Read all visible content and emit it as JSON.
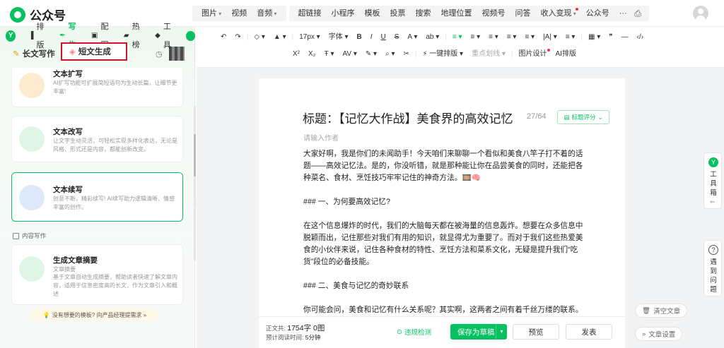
{
  "app": {
    "title": "公众号"
  },
  "topnav": {
    "group1": [
      "图片",
      "视频",
      "音频"
    ],
    "group2": [
      "超链接",
      "小程序",
      "模板",
      "投票",
      "搜索",
      "地理位置",
      "视频号",
      "问答",
      "收入变现",
      "公众号",
      "···"
    ]
  },
  "left": {
    "tabs": [
      "排版",
      "写作",
      "配图",
      "热榜",
      "工具"
    ],
    "modes": {
      "long": "长文写作",
      "short": "短文生成"
    },
    "cards": [
      {
        "title": "文本扩写",
        "desc": "AI扩写功能可扩展简短语句为生动长篇，让细节更丰富!"
      },
      {
        "title": "文本改写",
        "desc": "让文字生动灵活，可轻松实现多样化表达，无论是风格、形式还是内容，都能创新改变。"
      },
      {
        "title": "文本续写",
        "desc": "创意不断，精彩续写! AI续写助力逻辑清晰、情感丰富的创作。"
      },
      {
        "title": "生成文章摘要",
        "sub": "文章摘要",
        "desc": "基于文章自动生成摘要，帮助读者快速了解文章内容，适用于信息密度高的长文，作为文章引入和概述"
      }
    ],
    "section": "内容写作",
    "hint": "没有想要的模板? 向产品经理提需求 »"
  },
  "toolbar": {
    "row1": [
      "↶",
      "↷",
      "|",
      "◇ ▾",
      "▲ ▾",
      "|",
      "17px ▾",
      "字体 ▾",
      "B",
      "I",
      "U",
      "S",
      "A ▾",
      "ab ▾",
      "|",
      "≡ ▾",
      "≡ ▾",
      "≡ ▾",
      "≡ ▾",
      "≡ ▾",
      "|A| ▾",
      "≡ ▾",
      "|",
      "▦ ▾",
      "❞",
      "—",
      "‹/›"
    ],
    "row2": [
      "X²",
      "X₂",
      "Ŧ ▾",
      "AV ▾",
      "✎ ▾",
      "⌕ ▾",
      "✂",
      "|",
      "⚡ 一键排版 ▾",
      "重点划线 ▾",
      "|",
      "图片设计",
      "AI排版"
    ]
  },
  "editor": {
    "title": "标题：【记忆大作战】美食界的高效记忆",
    "title_count": "27/64",
    "score_label": "标题评分",
    "author_placeholder": "请输入作者",
    "paragraphs": [
      "大家好啊，我是你们的未闻助手！今天咱们来聊聊一个看似和美食八竿子打不着的话题——高效记忆法。是的，你没听错，就是那种能让你在品尝美食的同时，还能把各种菜名、食材、烹饪技巧牢牢记住的神奇方法。🎞️🧠",
      "### 一、为何要高效记忆?",
      "在这个信息爆炸的时代，我们的大脑每天都在被海量的信息轰炸。想要在众多信息中脱颖而出，记住那些对我们有用的知识，就显得尤为重要了。而对于我们这些热爱美食的小伙伴来说，记住各种食材的特性、烹饪方法和菜系文化，无疑是提升我们“吃货”段位的必备技能。",
      "### 二、美食与记忆的奇妙联系",
      "你可能会问，美食和记忆有什么关系呢？其实啊，这两者之间有着千丝万缕的联系。🥢🍃"
    ]
  },
  "footer": {
    "word_label": "正文共:",
    "word_value": "1754字 0图",
    "time_label": "预计阅读时间:",
    "time_value": "5分钟",
    "check": "违规检测",
    "save": "保存为草稿",
    "preview": "预览",
    "publish": "发表"
  },
  "side": {
    "tools": "工具箱",
    "help": "遇到问题",
    "clear": "清空文章",
    "settings": "文章设置"
  },
  "colors": {
    "brand": "#07c160",
    "highlight_border": "#d0142c"
  }
}
